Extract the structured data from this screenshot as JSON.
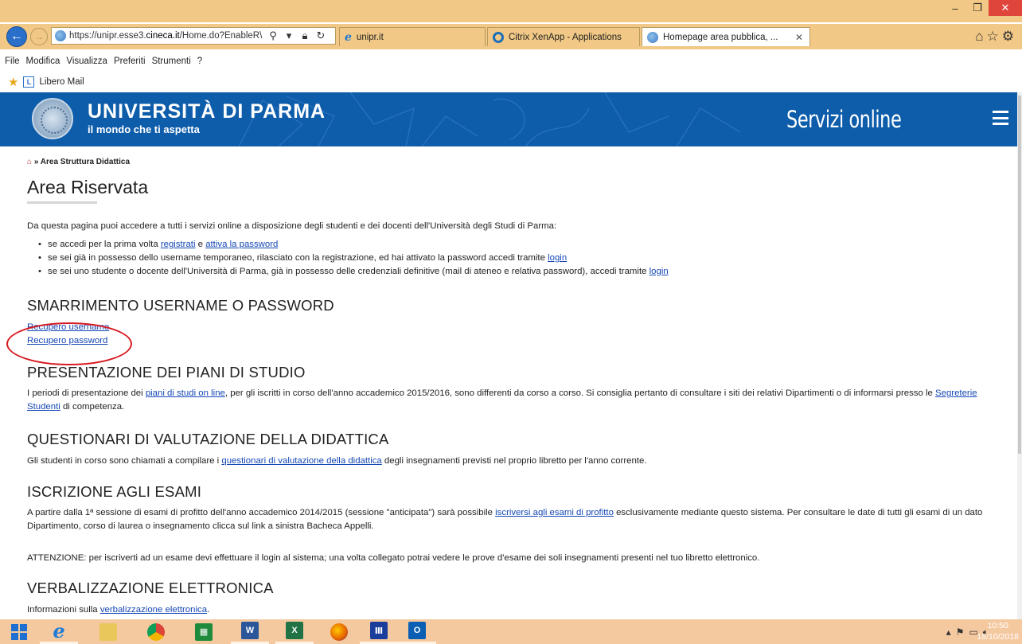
{
  "browser": {
    "url": "https://unipr.esse3.cineca.it/Home.do?EnableR\\",
    "url_domain": "cineca.it",
    "tabs": [
      {
        "label": "unipr.it",
        "icon": "ie-icon",
        "active": false
      },
      {
        "label": "Citrix XenApp - Applications",
        "icon": "citrix-icon",
        "active": false
      },
      {
        "label": "Homepage area pubblica, ...",
        "icon": "globe-icon",
        "active": true
      }
    ],
    "menu": [
      "File",
      "Modifica",
      "Visualizza",
      "Preferiti",
      "Strumenti",
      "?"
    ],
    "favorites": [
      {
        "label": "Libero Mail"
      }
    ]
  },
  "header": {
    "title": "UNIVERSITÀ DI PARMA",
    "subtitle": "il mondo che ti aspetta",
    "services": "Servizi online",
    "bg_color": "#0e5dab"
  },
  "breadcrumb": {
    "current": "Area Struttura Didattica"
  },
  "page_title": "Area Riservata",
  "intro": "Da questa pagina puoi accedere a tutti i servizi online a disposizione degli studenti e dei docenti dell'Università degli Studi di Parma:",
  "bullets": {
    "b1_pre": "se accedi per la prima volta ",
    "b1_link1": "registrati",
    "b1_mid": " e ",
    "b1_link2": "attiva la password",
    "b2_pre": "se sei già in possesso dello username temporaneo, rilasciato con la registrazione, ed hai attivato la password accedi tramite ",
    "b2_link": "login",
    "b3_pre": "se sei uno studente o docente dell'Università di Parma, già in possesso delle credenziali definitive (mail di ateneo e relativa password), accedi tramite ",
    "b3_link": "login"
  },
  "sections": {
    "lost": {
      "heading": "SMARRIMENTO USERNAME O PASSWORD",
      "link_username": "Recupero username",
      "link_password": "Recupero password"
    },
    "plans": {
      "heading": "PRESENTAZIONE DEI PIANI DI STUDIO",
      "t1": "I periodi di presentazione dei ",
      "l1": "piani di studi on line",
      "t2": ", per gli iscritti in corso dell'anno accademico 2015/2016, sono differenti da corso a corso. Si consiglia pertanto di consultare i siti dei relativi Dipartimenti o di informarsi presso le ",
      "l2": "Segreterie Studenti",
      "t3": " di competenza."
    },
    "questionari": {
      "heading": "QUESTIONARI DI VALUTAZIONE DELLA DIDATTICA",
      "t1": "Gli studenti in corso sono chiamati a compilare i ",
      "l1": "questionari di valutazione della didattica",
      "t2": " degli insegnamenti previsti nel proprio libretto per l'anno corrente."
    },
    "esami": {
      "heading": "ISCRIZIONE AGLI ESAMI",
      "t1": "A partire dalla 1ª sessione di esami di profitto dell'anno accademico 2014/2015 (sessione \"anticipata\") sarà possibile ",
      "l1": "iscriversi agli esami di profitto",
      "t2": " esclusivamente mediante questo sistema. Per consultare le date di tutti gli esami di un dato Dipartimento, corso di laurea o insegnamento clicca sul link a sinistra Bacheca Appelli.",
      "attention": "ATTENZIONE: per iscriverti ad un esame devi effettuare il login al sistema; una volta collegato potrai vedere le prove d'esame dei soli insegnamenti presenti nel tuo libretto elettronico."
    },
    "verbal": {
      "heading": "VERBALIZZAZIONE ELETTRONICA",
      "t1": "Informazioni sulla ",
      "l1": "verbalizzazione elettronica",
      "t2": "."
    }
  },
  "taskbar": {
    "time": "10:50",
    "date": "18/10/2018",
    "apps": [
      "start",
      "internet-explorer",
      "file-explorer",
      "chrome",
      "calculator",
      "word",
      "excel",
      "firefox",
      "app",
      "outlook"
    ]
  }
}
